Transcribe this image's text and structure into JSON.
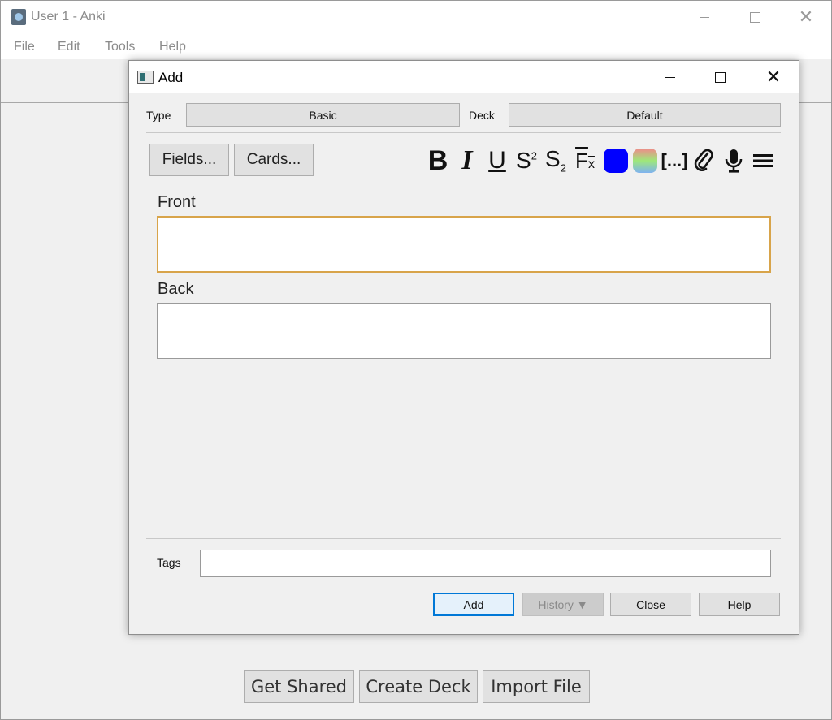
{
  "main_window": {
    "title": "User 1 - Anki",
    "menu": [
      "File",
      "Edit",
      "Tools",
      "Help"
    ],
    "bottom_buttons": {
      "get_shared": "Get Shared",
      "create_deck": "Create Deck",
      "import_file": "Import File"
    }
  },
  "add_dialog": {
    "title": "Add",
    "type_label": "Type",
    "type_value": "Basic",
    "deck_label": "Deck",
    "deck_value": "Default",
    "fields_button": "Fields...",
    "cards_button": "Cards...",
    "format_icons": [
      "bold-icon",
      "italic-icon",
      "underline-icon",
      "superscript-icon",
      "subscript-icon",
      "clear-format-icon",
      "text-color-icon",
      "highlight-color-icon",
      "cloze-icon",
      "attach-icon",
      "record-audio-icon",
      "more-menu-icon"
    ],
    "fields": [
      {
        "label": "Front",
        "value": ""
      },
      {
        "label": "Back",
        "value": ""
      }
    ],
    "tags_label": "Tags",
    "tags_value": "",
    "buttons": {
      "add": "Add",
      "history": "History ▼",
      "close": "Close",
      "help": "Help"
    },
    "colors": {
      "text_color": "#0000ff",
      "focus_border": "#d8a44a",
      "default_button_border": "#0078d7"
    }
  }
}
